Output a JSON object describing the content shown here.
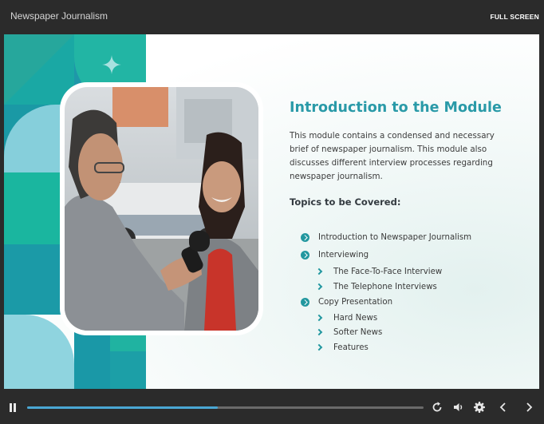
{
  "header": {
    "course_title": "Newspaper Journalism",
    "fullscreen_label": "FULL SCREEN"
  },
  "slide": {
    "heading": "Introduction to the Module",
    "description": "This module contains a condensed and necessary brief of newspaper journalism. This module also discusses different interview processes regarding newspaper journalism.",
    "topics_heading": "Topics to be Covered:",
    "topics": [
      {
        "label": "Introduction to Newspaper Journalism",
        "level": 1
      },
      {
        "label": "Interviewing",
        "level": 1
      },
      {
        "label": "The Face-To-Face Interview",
        "level": 2
      },
      {
        "label": "The Telephone Interviews",
        "level": 2
      },
      {
        "label": "Copy Presentation",
        "level": 1
      },
      {
        "label": "Hard News",
        "level": 2
      },
      {
        "label": "Softer News",
        "level": 2
      },
      {
        "label": "Features",
        "level": 2
      }
    ],
    "accent_color": "#2a9aa8"
  },
  "player": {
    "progress_fraction": 0.48,
    "progress_color": "#4aa7d3",
    "icons": [
      "pause-icon",
      "replay-icon",
      "volume-icon",
      "settings-icon",
      "previous-icon",
      "next-icon"
    ]
  }
}
